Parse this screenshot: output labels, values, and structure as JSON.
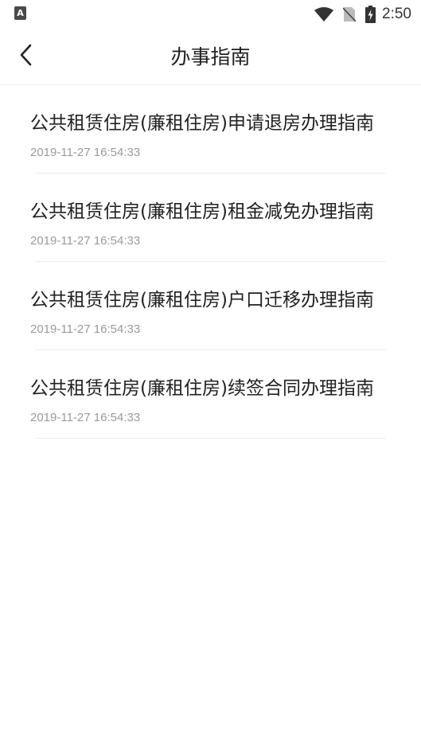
{
  "status_bar": {
    "app_icon_letter": "A",
    "time": "2:50"
  },
  "header": {
    "title": "办事指南"
  },
  "guides": [
    {
      "title": "公共租赁住房(廉租住房)申请退房办理指南",
      "date": "2019-11-27 16:54:33"
    },
    {
      "title": "公共租赁住房(廉租住房)租金减免办理指南",
      "date": "2019-11-27 16:54:33"
    },
    {
      "title": "公共租赁住房(廉租住房)户口迁移办理指南",
      "date": "2019-11-27 16:54:33"
    },
    {
      "title": "公共租赁住房(廉租住房)续签合同办理指南",
      "date": "2019-11-27 16:54:33"
    }
  ],
  "colors": {
    "title_text": "#222222",
    "date_text": "#9a9a9a",
    "divider": "#eeeeee"
  }
}
